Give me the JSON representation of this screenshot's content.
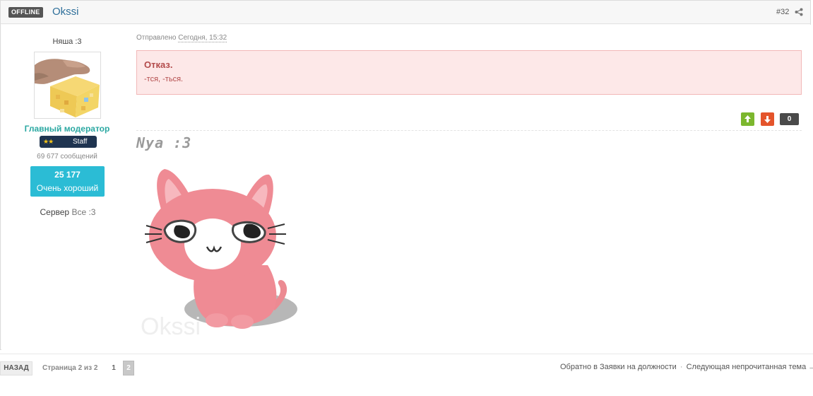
{
  "header": {
    "status_badge": "OFFLINE",
    "author": "Okssi",
    "post_number": "#32",
    "share_icon": "share-icon"
  },
  "sidebar": {
    "user_title": "Няша :3",
    "avatar_icon": "avatar-hand-cake-icon",
    "role": "Главный модератор",
    "staff_badge": "Staff",
    "messages": "69 677 сообщений",
    "reputation_value": "25 177",
    "reputation_label": "Очень хороший",
    "server_label": "Сервер",
    "server_value": "Все :3"
  },
  "post": {
    "sent_label": "Отправлено",
    "sent_time": "Сегодня, 15:32",
    "refusal_title": "Отказ.",
    "refusal_text": "-тся, -ться.",
    "vote_count": "0",
    "signature_text": "Nya :3",
    "signature_watermark": "Okssi"
  },
  "footer": {
    "back_label": "НАЗАД",
    "page_info": "Страница 2 из 2",
    "pages": [
      "1",
      "2"
    ],
    "back_to_forum": "Обратно в Заявки на должности",
    "separator": "·",
    "next_unread": "Следующая непрочитанная тема →"
  },
  "colors": {
    "author": "#2e6f9a",
    "role": "#2ba8a2",
    "reputation": "#2bbcd5",
    "refusal_bg": "#fde8e8",
    "refusal_text": "#b34b4b",
    "vote_up": "#7cb72e",
    "vote_down": "#e4542b"
  }
}
